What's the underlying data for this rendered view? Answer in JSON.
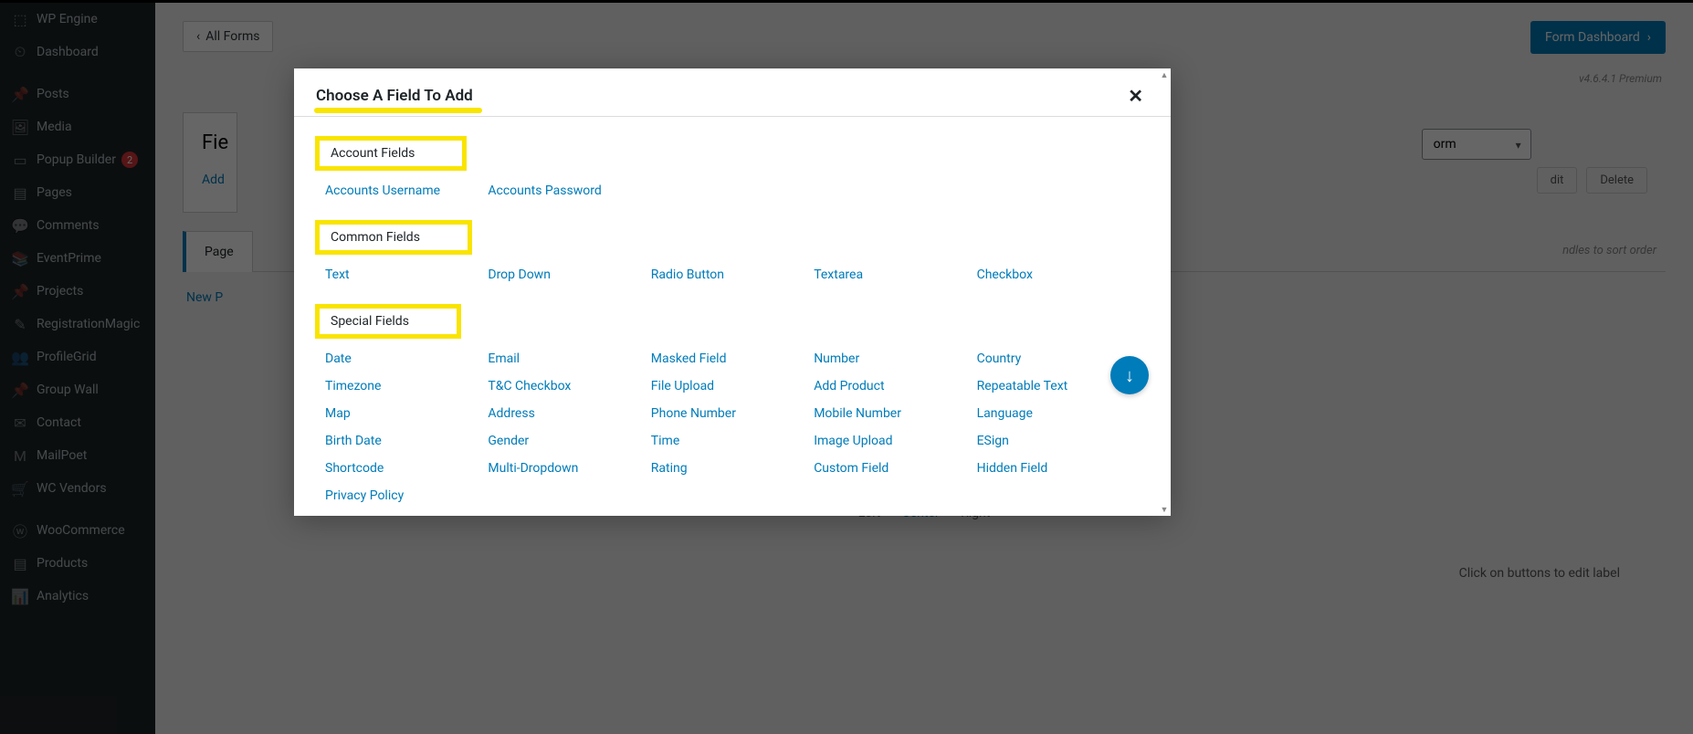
{
  "sidebar": {
    "items": [
      {
        "icon": "⬚",
        "label": "WP Engine"
      },
      {
        "icon": "⏲",
        "label": "Dashboard"
      },
      {
        "gap": true
      },
      {
        "icon": "📌",
        "label": "Posts"
      },
      {
        "icon": "🖼",
        "label": "Media"
      },
      {
        "icon": "▭",
        "label": "Popup Builder",
        "badge": "2"
      },
      {
        "icon": "▤",
        "label": "Pages"
      },
      {
        "icon": "💬",
        "label": "Comments"
      },
      {
        "icon": "📚",
        "label": "EventPrime"
      },
      {
        "icon": "📌",
        "label": "Projects"
      },
      {
        "icon": "✎",
        "label": "RegistrationMagic"
      },
      {
        "icon": "👥",
        "label": "ProfileGrid"
      },
      {
        "icon": "📌",
        "label": "Group Wall"
      },
      {
        "icon": "✉",
        "label": "Contact"
      },
      {
        "icon": "M",
        "label": "MailPoet"
      },
      {
        "icon": "🛒",
        "label": "WC Vendors"
      },
      {
        "gap": true
      },
      {
        "icon": "ⓦ",
        "label": "WooCommerce"
      },
      {
        "icon": "▤",
        "label": "Products"
      },
      {
        "icon": "📊",
        "label": "Analytics"
      }
    ]
  },
  "toolbar": {
    "back": "All Forms",
    "dashboard": "Form Dashboard",
    "version": "v4.6.4.1 Premium"
  },
  "panel": {
    "title_partial": "Fie",
    "add_partial": "Add",
    "formtype_partial": "orm",
    "tab_page": "Page",
    "tabs_hint": "ndles to sort order",
    "new_page": "New P",
    "edit": "dit",
    "delete": "Delete",
    "align_left": "Left",
    "align_center": "Center",
    "align_right": "Right",
    "edit_hint": "Click on buttons to edit label"
  },
  "modal": {
    "title": "Choose A Field To Add",
    "sections": [
      {
        "heading": "Account Fields",
        "fields": [
          "Accounts Username",
          "Accounts Password"
        ]
      },
      {
        "heading": "Common Fields",
        "fields": [
          "Text",
          "Drop Down",
          "Radio Button",
          "Textarea",
          "Checkbox"
        ]
      },
      {
        "heading": "Special Fields",
        "fields": [
          "Date",
          "Email",
          "Masked Field",
          "Number",
          "Country",
          "Timezone",
          "T&C Checkbox",
          "File Upload",
          "Add Product",
          "Repeatable Text",
          "Map",
          "Address",
          "Phone Number",
          "Mobile Number",
          "Language",
          "Birth Date",
          "Gender",
          "Time",
          "Image Upload",
          "ESign",
          "Shortcode",
          "Multi-Dropdown",
          "Rating",
          "Custom Field",
          "Hidden Field",
          "Privacy Policy"
        ]
      }
    ]
  }
}
